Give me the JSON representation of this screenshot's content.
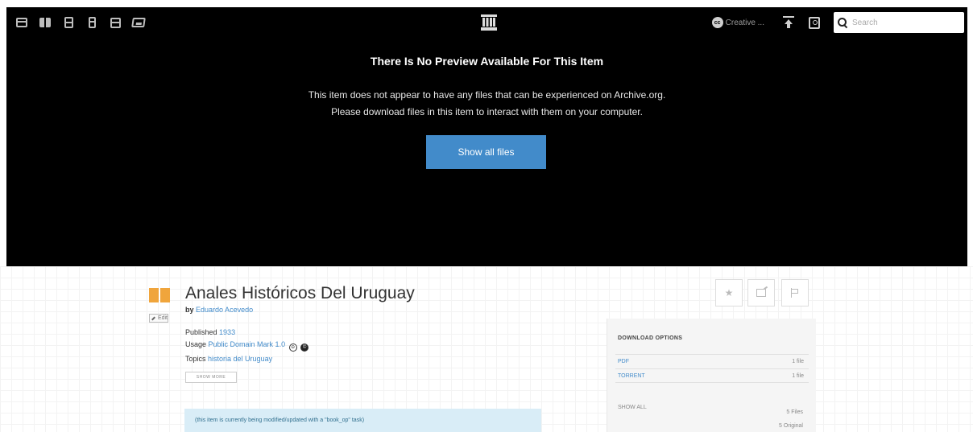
{
  "topbar": {
    "icons": [
      "web-icon",
      "texts-icon",
      "video-icon",
      "audio-icon",
      "software-icon",
      "images-icon"
    ],
    "logo": "archive-building-icon",
    "license_label": "Creative ...",
    "upload_icon": "upload-icon",
    "signin_icon": "sign-in-icon",
    "search_placeholder": "Search"
  },
  "theater": {
    "title": "There Is No Preview Available For This Item",
    "line1": "This item does not appear to have any files that can be experienced on Archive.org.",
    "line2": "Please download files in this item to interact with them on your computer.",
    "button_label": "Show all files",
    "button_color": "#428bca"
  },
  "item": {
    "title": "Anales Históricos Del Uruguay",
    "by_label": "by",
    "author": "Eduardo Acevedo",
    "published_label": "Published",
    "published_value": "1933",
    "usage_label": "Usage",
    "usage_value": "Public Domain Mark 1.0",
    "topics_label": "Topics",
    "topics_value": "historia del Uruguay",
    "show_more_label": "SHOW MORE",
    "notice": "(this item is currently being modified/updated with a \"book_op\" task)",
    "edit_label": "Edit"
  },
  "download": {
    "title": "DOWNLOAD OPTIONS",
    "rows": [
      {
        "label": "PDF",
        "count": "1 file"
      },
      {
        "label": "TORRENT",
        "count": "1 file"
      }
    ],
    "show_all_label": "SHOW ALL",
    "total_files": "5 Files",
    "original_files": "5 Original"
  },
  "actions": {
    "favorite_icon": "star-icon",
    "share_icon": "share-icon",
    "flag_icon": "flag-icon"
  },
  "colors": {
    "accent": "#428bca",
    "topbar_bg": "#000000",
    "item_icon": "#f0a53c",
    "notice_bg": "#d9edf7"
  }
}
